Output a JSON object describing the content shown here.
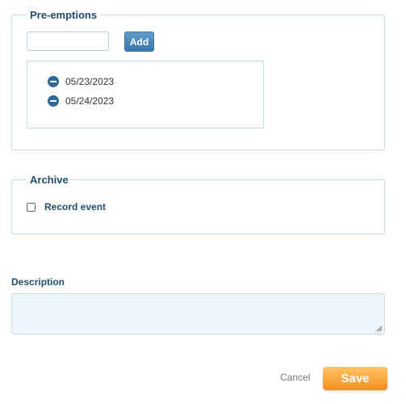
{
  "preemptions": {
    "legend": "Pre-emptions",
    "input_value": "",
    "add_label": "Add",
    "dates": [
      "05/23/2023",
      "05/24/2023"
    ]
  },
  "archive": {
    "legend": "Archive",
    "record_event_label": "Record event",
    "record_event_checked": false
  },
  "description": {
    "label": "Description",
    "value": ""
  },
  "actions": {
    "cancel_label": "Cancel",
    "save_label": "Save"
  },
  "colors": {
    "accent": "#2f6a98",
    "save": "#f5901e",
    "label": "#1f4e6e"
  }
}
